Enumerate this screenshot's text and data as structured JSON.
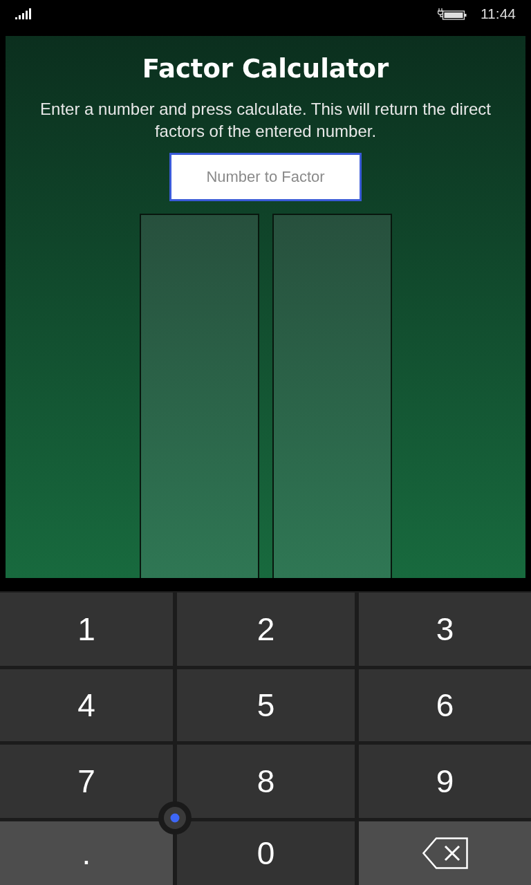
{
  "status_bar": {
    "time": "11:44"
  },
  "app": {
    "title": "Factor Calculator",
    "description": "Enter a number and press calculate. This will return the direct factors of the entered number.",
    "input": {
      "placeholder": "Number to Factor",
      "focused": true
    }
  },
  "keyboard": {
    "keys": [
      {
        "kind": "digit",
        "label": "1"
      },
      {
        "kind": "digit",
        "label": "2"
      },
      {
        "kind": "digit",
        "label": "3"
      },
      {
        "kind": "digit",
        "label": "4"
      },
      {
        "kind": "digit",
        "label": "5"
      },
      {
        "kind": "digit",
        "label": "6"
      },
      {
        "kind": "digit",
        "label": "7"
      },
      {
        "kind": "digit",
        "label": "8"
      },
      {
        "kind": "digit",
        "label": "9"
      },
      {
        "kind": "symbol",
        "label": "."
      },
      {
        "kind": "digit",
        "label": "0"
      },
      {
        "kind": "backspace"
      }
    ]
  }
}
